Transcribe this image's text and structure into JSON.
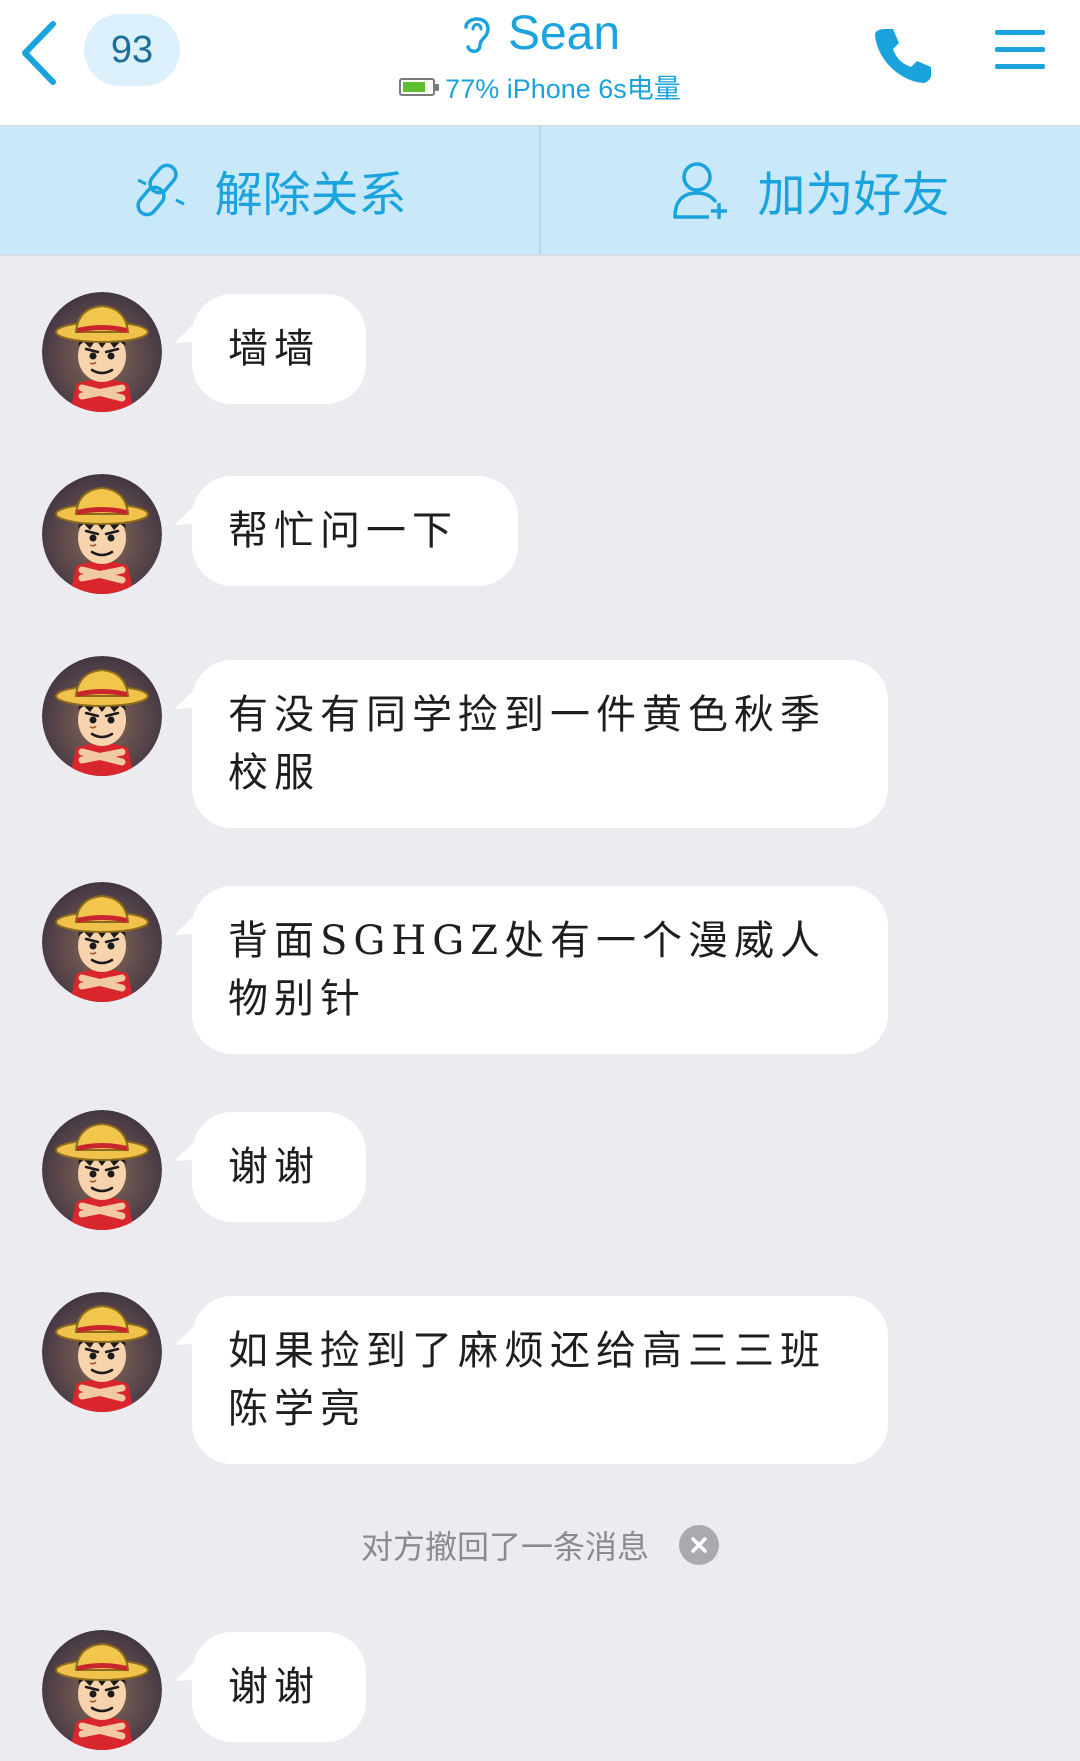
{
  "header": {
    "back_badge": "93",
    "title": "Sean",
    "device_status": "77% iPhone 6s电量",
    "battery_level": 0.77,
    "icons": [
      "back-chevron-icon",
      "ear-icon",
      "battery-icon",
      "phone-icon",
      "menu-icon"
    ]
  },
  "action_bar": {
    "unlink_label": "解除关系",
    "add_friend_label": "加为好友",
    "icons": [
      "broken-link-icon",
      "add-user-icon"
    ]
  },
  "messages": [
    {
      "text": "墙墙"
    },
    {
      "text": "帮忙问一下"
    },
    {
      "text": "有没有同学捡到一件黄色秋季校服"
    },
    {
      "text": "背面SGHGZ处有一个漫威人物别针"
    },
    {
      "text": "谢谢"
    },
    {
      "text": "如果捡到了麻烦还给高三三班陈学亮"
    },
    {
      "text": "谢谢"
    }
  ],
  "recall_notice": "对方撤回了一条消息",
  "colors": {
    "accent": "#1aa3dd",
    "chat_background": "#ebebf0",
    "action_bar": "#c9e8fa",
    "bubble": "#ffffff"
  }
}
